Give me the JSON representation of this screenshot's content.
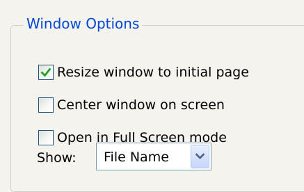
{
  "group": {
    "title": "Window Options"
  },
  "options": [
    {
      "label": "Resize window to initial page",
      "checked": true
    },
    {
      "label": "Center window on screen",
      "checked": false
    },
    {
      "label": "Open in Full Screen mode",
      "checked": false
    }
  ],
  "show": {
    "label": "Show:",
    "selected": "File Name"
  },
  "colors": {
    "legend_text": "#0046d5",
    "checkmark": "#21a121",
    "checkbox_border": "#1c5180",
    "dropdown_arrow": "#4d6185"
  }
}
